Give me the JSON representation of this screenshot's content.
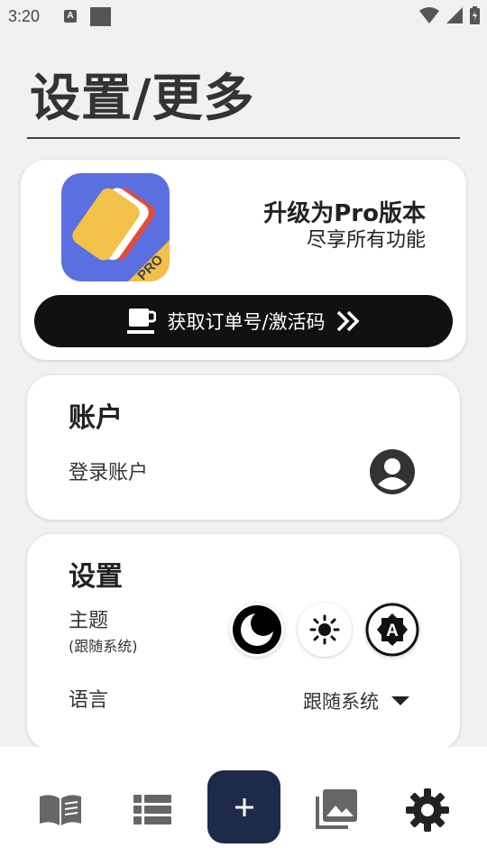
{
  "status_bar": {
    "time": "3:20",
    "notification_letter": "A"
  },
  "page_title": "设置/更多",
  "pro": {
    "title": "升级为Pro版本",
    "subtitle": "尽享所有功能",
    "badge": "PRO",
    "button_label": "获取订单号/激活码"
  },
  "account": {
    "title": "账户",
    "login_label": "登录账户"
  },
  "settings": {
    "title": "设置",
    "theme_label": "主题",
    "theme_sub": "(跟随系统)",
    "auto_icon_letter": "A",
    "language_label": "语言",
    "language_value": "跟随系统"
  },
  "colors": {
    "background": "#f1f1f3",
    "accent": "#1e2a4a",
    "pro_button": "#111111",
    "logo_blue": "#5a6fe0",
    "logo_yellow": "#f2c14a",
    "logo_red": "#e04c3b"
  },
  "icons": {
    "nav": [
      "book-icon",
      "list-icon",
      "add-icon",
      "image-icon",
      "gear-icon"
    ],
    "theme": [
      "moon-icon",
      "sun-icon",
      "auto-theme-icon"
    ]
  }
}
